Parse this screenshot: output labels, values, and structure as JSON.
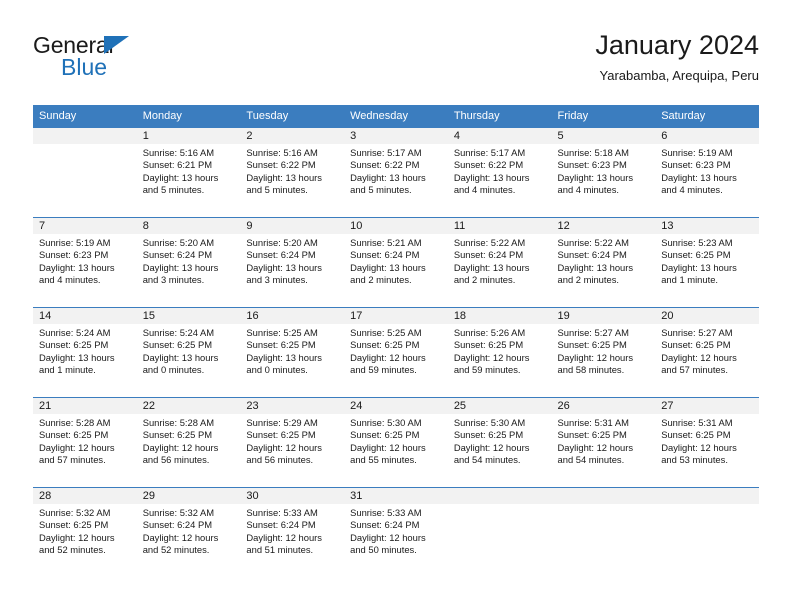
{
  "brand": {
    "word1": "General",
    "word2": "Blue",
    "triangle_color": "#1f71b8"
  },
  "header": {
    "title": "January 2024",
    "subtitle": "Yarabamba, Arequipa, Peru"
  },
  "theme": {
    "header_blue": "#3b7dbf",
    "daynum_bg": "#f2f2f2",
    "text": "#1a1a1a"
  },
  "columns": [
    "Sunday",
    "Monday",
    "Tuesday",
    "Wednesday",
    "Thursday",
    "Friday",
    "Saturday"
  ],
  "labels": {
    "sunrise": "Sunrise:",
    "sunset": "Sunset:",
    "daylight": "Daylight:"
  },
  "weeks": [
    [
      {
        "day": ""
      },
      {
        "day": "1",
        "sunrise": "Sunrise: 5:16 AM",
        "sunset": "Sunset: 6:21 PM",
        "daylight1": "Daylight: 13 hours",
        "daylight2": "and 5 minutes."
      },
      {
        "day": "2",
        "sunrise": "Sunrise: 5:16 AM",
        "sunset": "Sunset: 6:22 PM",
        "daylight1": "Daylight: 13 hours",
        "daylight2": "and 5 minutes."
      },
      {
        "day": "3",
        "sunrise": "Sunrise: 5:17 AM",
        "sunset": "Sunset: 6:22 PM",
        "daylight1": "Daylight: 13 hours",
        "daylight2": "and 5 minutes."
      },
      {
        "day": "4",
        "sunrise": "Sunrise: 5:17 AM",
        "sunset": "Sunset: 6:22 PM",
        "daylight1": "Daylight: 13 hours",
        "daylight2": "and 4 minutes."
      },
      {
        "day": "5",
        "sunrise": "Sunrise: 5:18 AM",
        "sunset": "Sunset: 6:23 PM",
        "daylight1": "Daylight: 13 hours",
        "daylight2": "and 4 minutes."
      },
      {
        "day": "6",
        "sunrise": "Sunrise: 5:19 AM",
        "sunset": "Sunset: 6:23 PM",
        "daylight1": "Daylight: 13 hours",
        "daylight2": "and 4 minutes."
      }
    ],
    [
      {
        "day": "7",
        "sunrise": "Sunrise: 5:19 AM",
        "sunset": "Sunset: 6:23 PM",
        "daylight1": "Daylight: 13 hours",
        "daylight2": "and 4 minutes."
      },
      {
        "day": "8",
        "sunrise": "Sunrise: 5:20 AM",
        "sunset": "Sunset: 6:24 PM",
        "daylight1": "Daylight: 13 hours",
        "daylight2": "and 3 minutes."
      },
      {
        "day": "9",
        "sunrise": "Sunrise: 5:20 AM",
        "sunset": "Sunset: 6:24 PM",
        "daylight1": "Daylight: 13 hours",
        "daylight2": "and 3 minutes."
      },
      {
        "day": "10",
        "sunrise": "Sunrise: 5:21 AM",
        "sunset": "Sunset: 6:24 PM",
        "daylight1": "Daylight: 13 hours",
        "daylight2": "and 2 minutes."
      },
      {
        "day": "11",
        "sunrise": "Sunrise: 5:22 AM",
        "sunset": "Sunset: 6:24 PM",
        "daylight1": "Daylight: 13 hours",
        "daylight2": "and 2 minutes."
      },
      {
        "day": "12",
        "sunrise": "Sunrise: 5:22 AM",
        "sunset": "Sunset: 6:24 PM",
        "daylight1": "Daylight: 13 hours",
        "daylight2": "and 2 minutes."
      },
      {
        "day": "13",
        "sunrise": "Sunrise: 5:23 AM",
        "sunset": "Sunset: 6:25 PM",
        "daylight1": "Daylight: 13 hours",
        "daylight2": "and 1 minute."
      }
    ],
    [
      {
        "day": "14",
        "sunrise": "Sunrise: 5:24 AM",
        "sunset": "Sunset: 6:25 PM",
        "daylight1": "Daylight: 13 hours",
        "daylight2": "and 1 minute."
      },
      {
        "day": "15",
        "sunrise": "Sunrise: 5:24 AM",
        "sunset": "Sunset: 6:25 PM",
        "daylight1": "Daylight: 13 hours",
        "daylight2": "and 0 minutes."
      },
      {
        "day": "16",
        "sunrise": "Sunrise: 5:25 AM",
        "sunset": "Sunset: 6:25 PM",
        "daylight1": "Daylight: 13 hours",
        "daylight2": "and 0 minutes."
      },
      {
        "day": "17",
        "sunrise": "Sunrise: 5:25 AM",
        "sunset": "Sunset: 6:25 PM",
        "daylight1": "Daylight: 12 hours",
        "daylight2": "and 59 minutes."
      },
      {
        "day": "18",
        "sunrise": "Sunrise: 5:26 AM",
        "sunset": "Sunset: 6:25 PM",
        "daylight1": "Daylight: 12 hours",
        "daylight2": "and 59 minutes."
      },
      {
        "day": "19",
        "sunrise": "Sunrise: 5:27 AM",
        "sunset": "Sunset: 6:25 PM",
        "daylight1": "Daylight: 12 hours",
        "daylight2": "and 58 minutes."
      },
      {
        "day": "20",
        "sunrise": "Sunrise: 5:27 AM",
        "sunset": "Sunset: 6:25 PM",
        "daylight1": "Daylight: 12 hours",
        "daylight2": "and 57 minutes."
      }
    ],
    [
      {
        "day": "21",
        "sunrise": "Sunrise: 5:28 AM",
        "sunset": "Sunset: 6:25 PM",
        "daylight1": "Daylight: 12 hours",
        "daylight2": "and 57 minutes."
      },
      {
        "day": "22",
        "sunrise": "Sunrise: 5:28 AM",
        "sunset": "Sunset: 6:25 PM",
        "daylight1": "Daylight: 12 hours",
        "daylight2": "and 56 minutes."
      },
      {
        "day": "23",
        "sunrise": "Sunrise: 5:29 AM",
        "sunset": "Sunset: 6:25 PM",
        "daylight1": "Daylight: 12 hours",
        "daylight2": "and 56 minutes."
      },
      {
        "day": "24",
        "sunrise": "Sunrise: 5:30 AM",
        "sunset": "Sunset: 6:25 PM",
        "daylight1": "Daylight: 12 hours",
        "daylight2": "and 55 minutes."
      },
      {
        "day": "25",
        "sunrise": "Sunrise: 5:30 AM",
        "sunset": "Sunset: 6:25 PM",
        "daylight1": "Daylight: 12 hours",
        "daylight2": "and 54 minutes."
      },
      {
        "day": "26",
        "sunrise": "Sunrise: 5:31 AM",
        "sunset": "Sunset: 6:25 PM",
        "daylight1": "Daylight: 12 hours",
        "daylight2": "and 54 minutes."
      },
      {
        "day": "27",
        "sunrise": "Sunrise: 5:31 AM",
        "sunset": "Sunset: 6:25 PM",
        "daylight1": "Daylight: 12 hours",
        "daylight2": "and 53 minutes."
      }
    ],
    [
      {
        "day": "28",
        "sunrise": "Sunrise: 5:32 AM",
        "sunset": "Sunset: 6:25 PM",
        "daylight1": "Daylight: 12 hours",
        "daylight2": "and 52 minutes."
      },
      {
        "day": "29",
        "sunrise": "Sunrise: 5:32 AM",
        "sunset": "Sunset: 6:24 PM",
        "daylight1": "Daylight: 12 hours",
        "daylight2": "and 52 minutes."
      },
      {
        "day": "30",
        "sunrise": "Sunrise: 5:33 AM",
        "sunset": "Sunset: 6:24 PM",
        "daylight1": "Daylight: 12 hours",
        "daylight2": "and 51 minutes."
      },
      {
        "day": "31",
        "sunrise": "Sunrise: 5:33 AM",
        "sunset": "Sunset: 6:24 PM",
        "daylight1": "Daylight: 12 hours",
        "daylight2": "and 50 minutes."
      },
      {
        "day": ""
      },
      {
        "day": ""
      },
      {
        "day": ""
      }
    ]
  ]
}
